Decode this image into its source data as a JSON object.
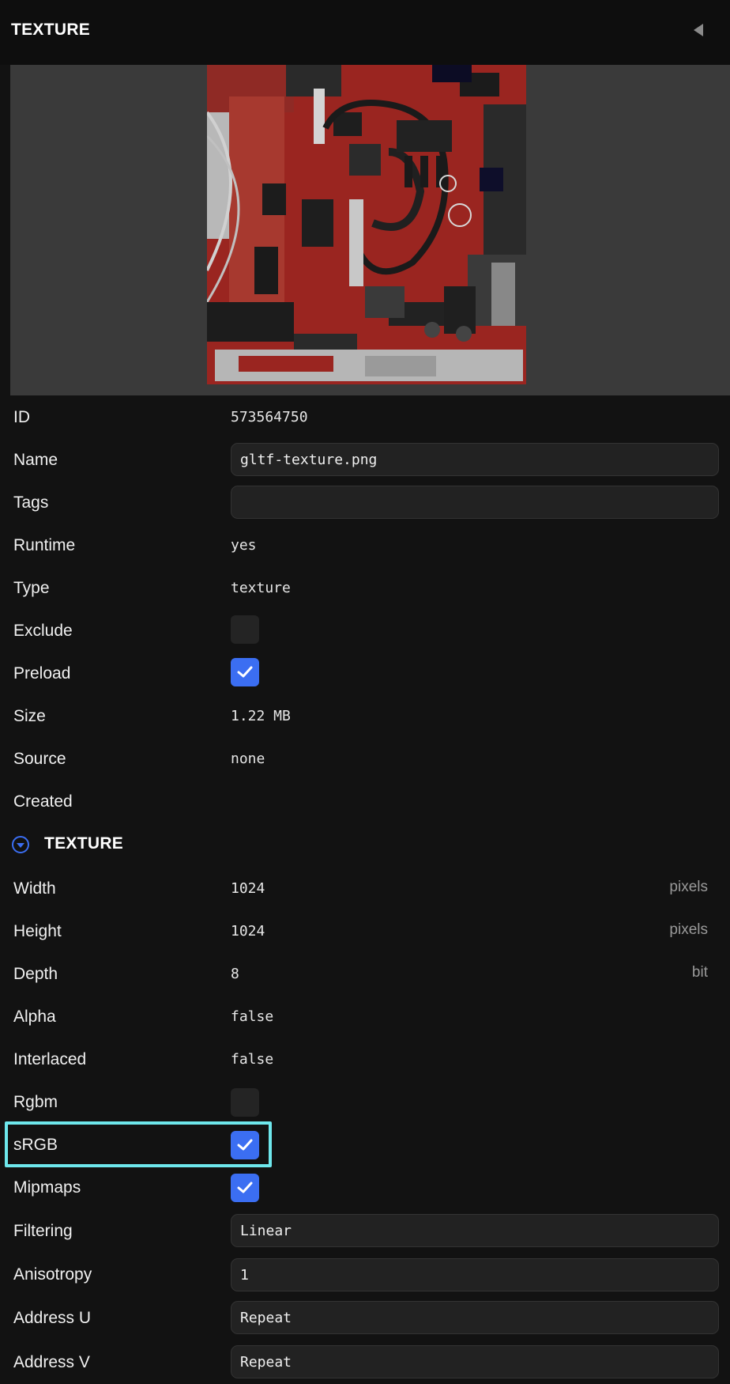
{
  "header": {
    "title": "TEXTURE",
    "collapse_icon": "collapse-left-arrow-icon"
  },
  "preview": {
    "alt": "texture preview"
  },
  "asset": {
    "id_label": "ID",
    "id_value": "573564750",
    "name_label": "Name",
    "name_value": "gltf-texture.png",
    "tags_label": "Tags",
    "tags_value": "",
    "runtime_label": "Runtime",
    "runtime_value": "yes",
    "type_label": "Type",
    "type_value": "texture",
    "exclude_label": "Exclude",
    "exclude_checked": false,
    "preload_label": "Preload",
    "preload_checked": true,
    "size_label": "Size",
    "size_value": "1.22 MB",
    "source_label": "Source",
    "source_value": "none",
    "created_label": "Created",
    "created_value": ""
  },
  "texture": {
    "section_title": "TEXTURE",
    "section_icon": "chevron-down-circle-icon",
    "width_label": "Width",
    "width_value": "1024",
    "width_unit": "pixels",
    "height_label": "Height",
    "height_value": "1024",
    "height_unit": "pixels",
    "depth_label": "Depth",
    "depth_value": "8",
    "depth_unit": "bit",
    "alpha_label": "Alpha",
    "alpha_value": "false",
    "interlaced_label": "Interlaced",
    "interlaced_value": "false",
    "rgbm_label": "Rgbm",
    "rgbm_checked": false,
    "srgb_label": "sRGB",
    "srgb_checked": true,
    "mipmaps_label": "Mipmaps",
    "mipmaps_checked": true,
    "filtering_label": "Filtering",
    "filtering_value": "Linear",
    "anisotropy_label": "Anisotropy",
    "anisotropy_value": "1",
    "address_u_label": "Address U",
    "address_u_value": "Repeat",
    "address_v_label": "Address V",
    "address_v_value": "Repeat"
  },
  "colors": {
    "accent": "#3b6ef2",
    "highlight": "#6ee7ec",
    "background": "#121212"
  }
}
